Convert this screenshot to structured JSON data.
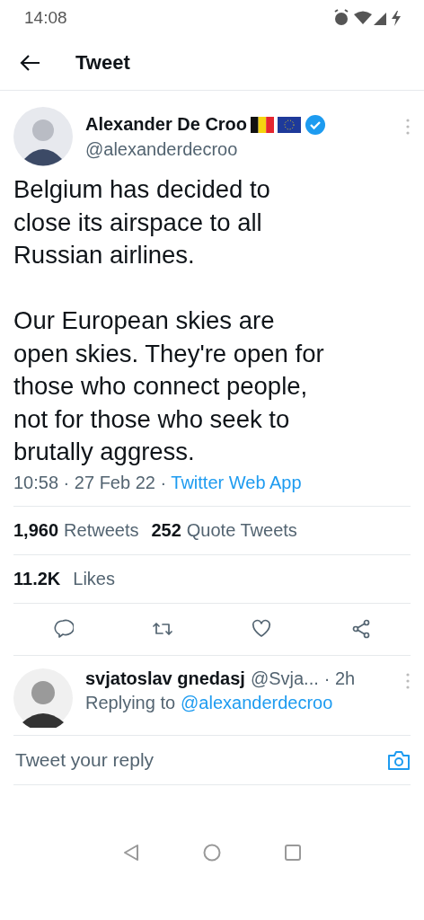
{
  "status_bar": {
    "time": "14:08"
  },
  "header": {
    "title": "Tweet"
  },
  "tweet": {
    "author": {
      "name": "Alexander De Croo",
      "handle": "@alexanderdecroo",
      "verified": true
    },
    "paragraphs": [
      [
        "Belgium has decided to",
        "close its airspace to all",
        "Russian airlines."
      ],
      [
        "Our European skies are",
        "open skies. They're open for",
        "those who connect people,",
        "not for those who seek to",
        "brutally aggress."
      ]
    ],
    "time": "10:58 · 27 Feb 22 · ",
    "source": "Twitter Web App",
    "stats": [
      {
        "count": "1,960",
        "label": "Retweets"
      },
      {
        "count": "252",
        "label": "Quote Tweets"
      }
    ],
    "likes": {
      "count": "11.2K",
      "label": "Likes"
    },
    "actions": [
      {
        "kind": "reply"
      },
      {
        "kind": "retweet"
      },
      {
        "kind": "like"
      },
      {
        "kind": "share"
      }
    ]
  },
  "reply": {
    "name": "svjatoslav gnedasj",
    "handle": "@Svja...",
    "time": "· 2h",
    "replying_prefix": "Replying to",
    "replying_to": "@alexanderdecroo"
  },
  "composer": {
    "placeholder": "Tweet your reply"
  }
}
